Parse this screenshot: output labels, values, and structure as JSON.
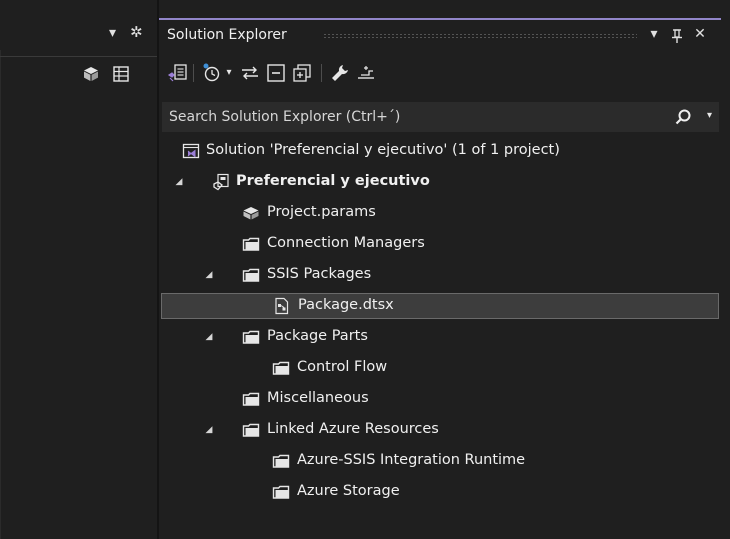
{
  "left_pane": {
    "dropdown_glyph": "▾",
    "gear_glyph": "✲"
  },
  "solution_explorer": {
    "title": "Solution Explorer",
    "title_controls": {
      "dropdown": "▾",
      "pin": "ꟸ",
      "close": "✕"
    },
    "search": {
      "placeholder": "Search Solution Explorer (Ctrl+´)"
    },
    "tree": [
      {
        "label": "Solution 'Preferencial y ejecutivo' (1 of 1 project)",
        "icon": "solution-icon",
        "expanded": null,
        "bold": false,
        "selected": false
      },
      {
        "label": "Preferencial y ejecutivo",
        "icon": "ssis-project-icon",
        "expanded": true,
        "bold": true,
        "selected": false
      },
      {
        "label": "Project.params",
        "icon": "params-icon",
        "expanded": null,
        "bold": false,
        "selected": false
      },
      {
        "label": "Connection Managers",
        "icon": "folder-icon",
        "expanded": null,
        "bold": false,
        "selected": false
      },
      {
        "label": "SSIS Packages",
        "icon": "folder-icon",
        "expanded": true,
        "bold": false,
        "selected": false
      },
      {
        "label": "Package.dtsx",
        "icon": "package-icon",
        "expanded": null,
        "bold": false,
        "selected": true
      },
      {
        "label": "Package Parts",
        "icon": "folder-icon",
        "expanded": true,
        "bold": false,
        "selected": false
      },
      {
        "label": "Control Flow",
        "icon": "folder-icon",
        "expanded": null,
        "bold": false,
        "selected": false
      },
      {
        "label": "Miscellaneous",
        "icon": "folder-icon",
        "expanded": null,
        "bold": false,
        "selected": false
      },
      {
        "label": "Linked Azure Resources",
        "icon": "folder-icon",
        "expanded": true,
        "bold": false,
        "selected": false
      },
      {
        "label": "Azure-SSIS Integration Runtime",
        "icon": "folder-icon",
        "expanded": null,
        "bold": false,
        "selected": false
      },
      {
        "label": "Azure Storage",
        "icon": "folder-icon",
        "expanded": null,
        "bold": false,
        "selected": false
      }
    ]
  },
  "colors": {
    "background": "#1f1f1f",
    "accent": "#9185c8",
    "selection": "#3d3d3d",
    "solution_icon": "#9b7fd6",
    "history_icon_dot": "#3f8fd6"
  }
}
